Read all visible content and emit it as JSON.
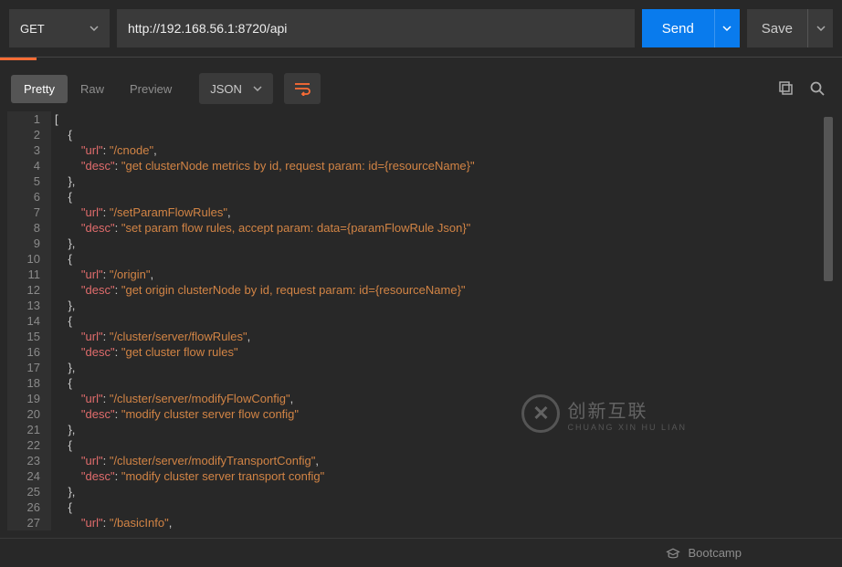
{
  "request": {
    "method": "GET",
    "url": "http://192.168.56.1:8720/api",
    "send_label": "Send",
    "save_label": "Save"
  },
  "response_tabs": {
    "pretty": "Pretty",
    "raw": "Raw",
    "preview": "Preview",
    "format": "JSON"
  },
  "code": {
    "lines": [
      {
        "n": 1,
        "t": "punc",
        "text": "["
      },
      {
        "n": 2,
        "t": "punc",
        "indent": 1,
        "text": "{"
      },
      {
        "n": 3,
        "t": "kv",
        "indent": 2,
        "key": "\"url\"",
        "val": "\"/cnode\"",
        "trail": ","
      },
      {
        "n": 4,
        "t": "kv",
        "indent": 2,
        "key": "\"desc\"",
        "val": "\"get clusterNode metrics by id, request param: id={resourceName}\"",
        "trail": ""
      },
      {
        "n": 5,
        "t": "punc",
        "indent": 1,
        "text": "},"
      },
      {
        "n": 6,
        "t": "punc",
        "indent": 1,
        "text": "{"
      },
      {
        "n": 7,
        "t": "kv",
        "indent": 2,
        "key": "\"url\"",
        "val": "\"/setParamFlowRules\"",
        "trail": ","
      },
      {
        "n": 8,
        "t": "kv",
        "indent": 2,
        "key": "\"desc\"",
        "val": "\"set param flow rules, accept param: data={paramFlowRule Json}\"",
        "trail": ""
      },
      {
        "n": 9,
        "t": "punc",
        "indent": 1,
        "text": "},"
      },
      {
        "n": 10,
        "t": "punc",
        "indent": 1,
        "text": "{"
      },
      {
        "n": 11,
        "t": "kv",
        "indent": 2,
        "key": "\"url\"",
        "val": "\"/origin\"",
        "trail": ","
      },
      {
        "n": 12,
        "t": "kv",
        "indent": 2,
        "key": "\"desc\"",
        "val": "\"get origin clusterNode by id, request param: id={resourceName}\"",
        "trail": ""
      },
      {
        "n": 13,
        "t": "punc",
        "indent": 1,
        "text": "},"
      },
      {
        "n": 14,
        "t": "punc",
        "indent": 1,
        "text": "{"
      },
      {
        "n": 15,
        "t": "kv",
        "indent": 2,
        "key": "\"url\"",
        "val": "\"/cluster/server/flowRules\"",
        "trail": ","
      },
      {
        "n": 16,
        "t": "kv",
        "indent": 2,
        "key": "\"desc\"",
        "val": "\"get cluster flow rules\"",
        "trail": ""
      },
      {
        "n": 17,
        "t": "punc",
        "indent": 1,
        "text": "},"
      },
      {
        "n": 18,
        "t": "punc",
        "indent": 1,
        "text": "{"
      },
      {
        "n": 19,
        "t": "kv",
        "indent": 2,
        "key": "\"url\"",
        "val": "\"/cluster/server/modifyFlowConfig\"",
        "trail": ","
      },
      {
        "n": 20,
        "t": "kv",
        "indent": 2,
        "key": "\"desc\"",
        "val": "\"modify cluster server flow config\"",
        "trail": ""
      },
      {
        "n": 21,
        "t": "punc",
        "indent": 1,
        "text": "},"
      },
      {
        "n": 22,
        "t": "punc",
        "indent": 1,
        "text": "{"
      },
      {
        "n": 23,
        "t": "kv",
        "indent": 2,
        "key": "\"url\"",
        "val": "\"/cluster/server/modifyTransportConfig\"",
        "trail": ","
      },
      {
        "n": 24,
        "t": "kv",
        "indent": 2,
        "key": "\"desc\"",
        "val": "\"modify cluster server transport config\"",
        "trail": ""
      },
      {
        "n": 25,
        "t": "punc",
        "indent": 1,
        "text": "},"
      },
      {
        "n": 26,
        "t": "punc",
        "indent": 1,
        "text": "{"
      },
      {
        "n": 27,
        "t": "kv",
        "indent": 2,
        "key": "\"url\"",
        "val": "\"/basicInfo\"",
        "trail": ","
      }
    ]
  },
  "watermark": {
    "cn": "创新互联",
    "py": "CHUANG XIN HU LIAN"
  },
  "footer": {
    "bootcamp": "Bootcamp"
  }
}
